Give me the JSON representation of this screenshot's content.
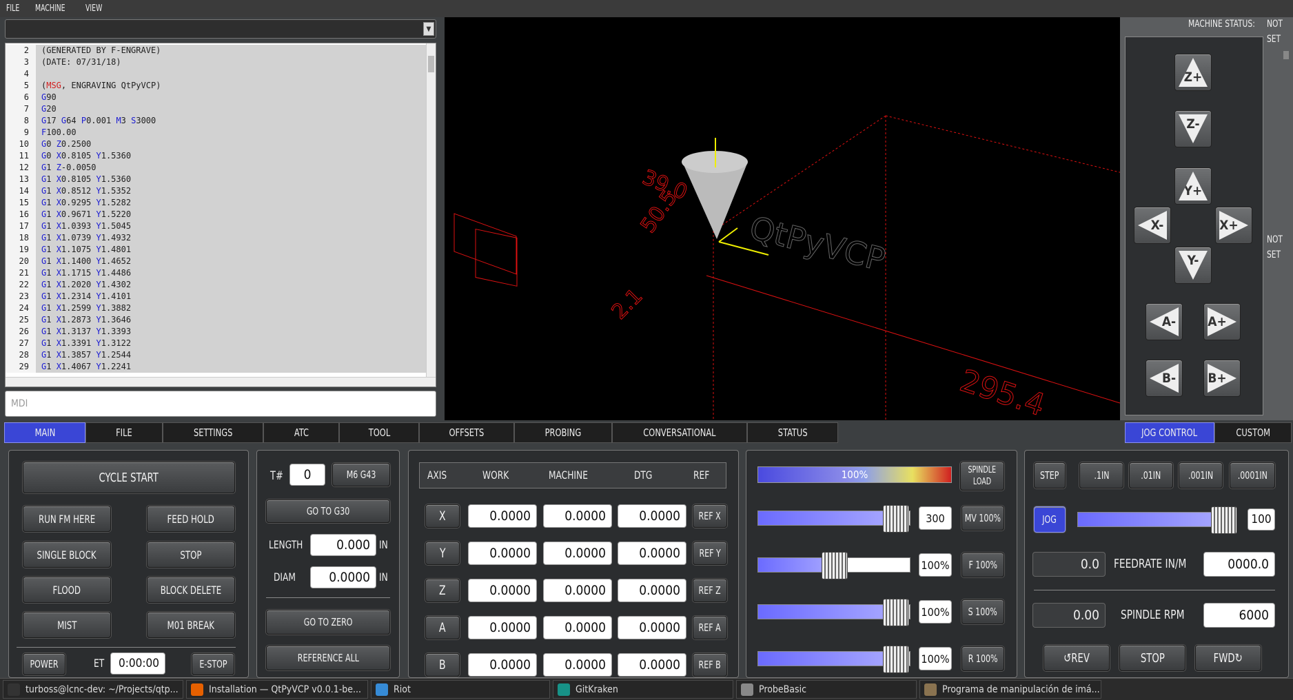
{
  "menu": [
    "FILE",
    "MACHINE",
    "VIEW"
  ],
  "editor": {
    "lines": [
      {
        "n": "2",
        "t": "(GENERATED BY F-ENGRAVE)"
      },
      {
        "n": "3",
        "t": "(DATE: 07/31/18)"
      },
      {
        "n": "4",
        "t": ""
      },
      {
        "n": "5",
        "t": "(MSG, ENGRAVING QtPyVCP)"
      },
      {
        "n": "6",
        "t": "G90"
      },
      {
        "n": "7",
        "t": "G20"
      },
      {
        "n": "8",
        "t": "G17 G64 P0.001 M3 S3000"
      },
      {
        "n": "9",
        "t": "F100.00"
      },
      {
        "n": "10",
        "t": "G0 Z0.2500"
      },
      {
        "n": "11",
        "t": "G0 X0.8105 Y1.5360"
      },
      {
        "n": "12",
        "t": "G1 Z-0.0050"
      },
      {
        "n": "13",
        "t": "G1 X0.8105 Y1.5360"
      },
      {
        "n": "14",
        "t": "G1 X0.8512 Y1.5352"
      },
      {
        "n": "15",
        "t": "G1 X0.9295 Y1.5282"
      },
      {
        "n": "16",
        "t": "G1 X0.9671 Y1.5220"
      },
      {
        "n": "17",
        "t": "G1 X1.0393 Y1.5045"
      },
      {
        "n": "18",
        "t": "G1 X1.0739 Y1.4932"
      },
      {
        "n": "19",
        "t": "G1 X1.1075 Y1.4801"
      },
      {
        "n": "20",
        "t": "G1 X1.1400 Y1.4652"
      },
      {
        "n": "21",
        "t": "G1 X1.1715 Y1.4486"
      },
      {
        "n": "22",
        "t": "G1 X1.2020 Y1.4302"
      },
      {
        "n": "23",
        "t": "G1 X1.2314 Y1.4101"
      },
      {
        "n": "24",
        "t": "G1 X1.2599 Y1.3882"
      },
      {
        "n": "25",
        "t": "G1 X1.2873 Y1.3646"
      },
      {
        "n": "26",
        "t": "G1 X1.3137 Y1.3393"
      },
      {
        "n": "27",
        "t": "G1 X1.3391 Y1.3122"
      },
      {
        "n": "28",
        "t": "G1 X1.3857 Y1.2544"
      },
      {
        "n": "29",
        "t": "G1 X1.4067 Y1.2241"
      }
    ],
    "mdi_placeholder": "MDI"
  },
  "viewport": {
    "dims": [
      "39.0",
      "50.5",
      "2.1",
      "295.4"
    ],
    "engraved_text": "QtPyVCP"
  },
  "status": {
    "label": "MACHINE STATUS:",
    "value_top": [
      "NOT",
      "SET"
    ],
    "value_mid": [
      "NOT",
      "SET"
    ]
  },
  "jog": {
    "zplus": "Z+",
    "zminus": "Z-",
    "yplus": "Y+",
    "yminus": "Y-",
    "xminus": "X-",
    "xplus": "X+",
    "aminus": "A-",
    "aplus": "A+",
    "bminus": "B-",
    "bplus": "B+"
  },
  "tabs": [
    "MAIN",
    "FILE",
    "SETTINGS",
    "ATC",
    "TOOL",
    "OFFSETS",
    "PROBING",
    "CONVERSATIONAL",
    "STATUS"
  ],
  "right_tabs": [
    "JOG CONTROL",
    "CUSTOM"
  ],
  "program": {
    "cycle_start": "CYCLE START",
    "run_from_here": "RUN FM HERE",
    "feed_hold": "FEED HOLD",
    "single_block": "SINGLE BLOCK",
    "stop": "STOP",
    "flood": "FLOOD",
    "block_delete": "BLOCK DELETE",
    "mist": "MIST",
    "m01_break": "M01 BREAK",
    "power": "POWER",
    "et_label": "ET",
    "et_value": "0:00:00",
    "estop": "E-STOP"
  },
  "tool": {
    "t_label": "T#",
    "t_value": "0",
    "m6g43": "M6 G43",
    "go_g30": "GO TO G30",
    "length_label": "LENGTH",
    "length_value": "0.000",
    "length_unit": "IN",
    "diam_label": "DIAM",
    "diam_value": "0.0000",
    "diam_unit": "IN",
    "go_zero": "GO TO ZERO",
    "ref_all": "REFERENCE ALL"
  },
  "dro": {
    "headers": [
      "AXIS",
      "WORK",
      "MACHINE",
      "DTG",
      "REF"
    ],
    "rows": [
      {
        "axis": "X",
        "work": "0.0000",
        "machine": "0.0000",
        "dtg": "0.0000",
        "ref": "REF X"
      },
      {
        "axis": "Y",
        "work": "0.0000",
        "machine": "0.0000",
        "dtg": "0.0000",
        "ref": "REF Y"
      },
      {
        "axis": "Z",
        "work": "0.0000",
        "machine": "0.0000",
        "dtg": "0.0000",
        "ref": "REF Z"
      },
      {
        "axis": "A",
        "work": "0.0000",
        "machine": "0.0000",
        "dtg": "0.0000",
        "ref": "REF A"
      },
      {
        "axis": "B",
        "work": "0.0000",
        "machine": "0.0000",
        "dtg": "0.0000",
        "ref": "REF B"
      }
    ]
  },
  "overrides": {
    "spindle_load_pct": "100%",
    "spindle_load_label": [
      "SPINDLE",
      "LOAD"
    ],
    "rows": [
      {
        "level": 0.9,
        "value": "300",
        "btn": "MV 100%"
      },
      {
        "level": 0.5,
        "value": "100%",
        "btn": "F 100%"
      },
      {
        "level": 0.9,
        "value": "100%",
        "btn": "S 100%"
      },
      {
        "level": 0.9,
        "value": "100%",
        "btn": "R 100%"
      }
    ]
  },
  "jogctl": {
    "step": "STEP",
    "inc": [
      ".1IN",
      ".01IN",
      ".001IN",
      ".0001IN"
    ],
    "jog": "JOG",
    "jog_level": 0.92,
    "jog_value": "100",
    "feed_actual": "0.0",
    "feed_label": "FEEDRATE IN/M",
    "feed_set": "0000.0",
    "spindle_actual": "0.00",
    "spindle_label": "SPINDLE RPM",
    "spindle_set": "6000",
    "rev": "↺REV",
    "stop": "STOP",
    "fwd": "FWD↻"
  },
  "taskbar": [
    {
      "label": "turboss@lcnc-dev: ~/Projects/qtp...",
      "icon": "terminal-icon",
      "color": "#333"
    },
    {
      "label": "Installation — QtPyVCP v0.0.1-be...",
      "icon": "firefox-icon",
      "color": "#e66000"
    },
    {
      "label": "Riot",
      "icon": "riot-icon",
      "color": "#368bd6"
    },
    {
      "label": "GitKraken",
      "icon": "gitkraken-icon",
      "color": "#179287"
    },
    {
      "label": "ProbeBasic",
      "icon": "window-icon",
      "color": "#888"
    },
    {
      "label": "Programa de manipulación de imá...",
      "icon": "gimp-icon",
      "color": "#8a7350"
    }
  ]
}
